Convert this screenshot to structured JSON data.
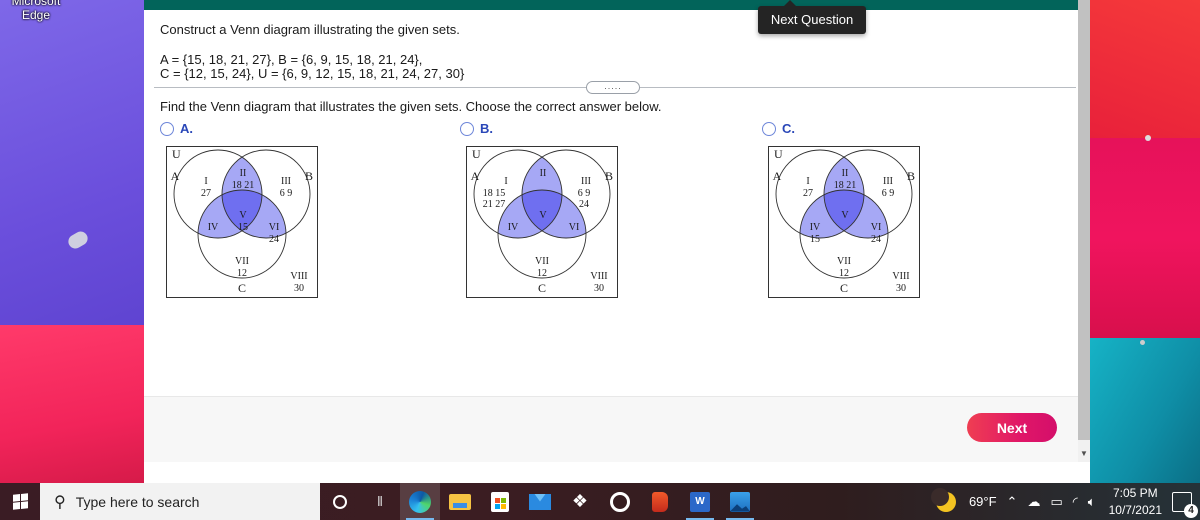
{
  "desktop": {
    "icon_label_line1": "Microsoft",
    "icon_label_line2": "Edge"
  },
  "tooltip": {
    "text": "Next Question"
  },
  "question": {
    "title": "Construct a Venn diagram illustrating the given sets.",
    "set_line1": "A = {15, 18, 21, 27}, B = {6, 9, 15, 18, 21, 24},",
    "set_line2": "C = {12, 15, 24}, U = {6, 9, 12, 15, 18, 21, 24, 27, 30}",
    "more_indicator": ".....",
    "instruction": "Find the Venn diagram that illustrates the given sets.  Choose the correct answer below."
  },
  "options": [
    {
      "label": "A.",
      "venn": {
        "set_labels": {
          "U": "U",
          "A": "A",
          "B": "B",
          "C": "C"
        },
        "regions": {
          "I": {
            "name": "I",
            "values": [
              "27"
            ]
          },
          "II": {
            "name": "II",
            "values": [
              "18 21"
            ]
          },
          "III": {
            "name": "III",
            "values": [
              "6  9"
            ]
          },
          "IV": {
            "name": "IV",
            "values": []
          },
          "V": {
            "name": "V",
            "values": [
              "15"
            ]
          },
          "VI": {
            "name": "VI",
            "values": [
              "24"
            ]
          },
          "VII": {
            "name": "VII",
            "values": [
              "12"
            ]
          },
          "VIII": {
            "name": "VIII",
            "values": [
              "30"
            ]
          }
        }
      }
    },
    {
      "label": "B.",
      "venn": {
        "set_labels": {
          "U": "U",
          "A": "A",
          "B": "B",
          "C": "C"
        },
        "regions": {
          "I": {
            "name": "I",
            "values": [
              "18 15",
              "21 27"
            ]
          },
          "II": {
            "name": "II",
            "values": []
          },
          "III": {
            "name": "III",
            "values": [
              "6  9",
              "24"
            ]
          },
          "IV": {
            "name": "IV",
            "values": []
          },
          "V": {
            "name": "V",
            "values": []
          },
          "VI": {
            "name": "VI",
            "values": []
          },
          "VII": {
            "name": "VII",
            "values": [
              "12"
            ]
          },
          "VIII": {
            "name": "VIII",
            "values": [
              "30"
            ]
          }
        }
      }
    },
    {
      "label": "C.",
      "venn": {
        "set_labels": {
          "U": "U",
          "A": "A",
          "B": "B",
          "C": "C"
        },
        "regions": {
          "I": {
            "name": "I",
            "values": [
              "27"
            ]
          },
          "II": {
            "name": "II",
            "values": [
              "18 21"
            ]
          },
          "III": {
            "name": "III",
            "values": [
              "6  9"
            ]
          },
          "IV": {
            "name": "IV",
            "values": [
              "15"
            ]
          },
          "V": {
            "name": "V",
            "values": []
          },
          "VI": {
            "name": "VI",
            "values": [
              "24"
            ]
          },
          "VII": {
            "name": "VII",
            "values": [
              "12"
            ]
          },
          "VIII": {
            "name": "VIII",
            "values": [
              "30"
            ]
          }
        }
      }
    }
  ],
  "next_button": {
    "label": "Next"
  },
  "colors": {
    "header": "#02645a",
    "venn_fill_light": "#a6a8f5",
    "venn_fill_dark": "#6f6ff0",
    "option_label": "#2a47b8",
    "next_button": "#e01668"
  },
  "taskbar": {
    "search_placeholder": "Type here to search",
    "weather": "69°F",
    "time": "7:05 PM",
    "date": "10/7/2021",
    "notification_count": "4",
    "word_letter": "W"
  }
}
